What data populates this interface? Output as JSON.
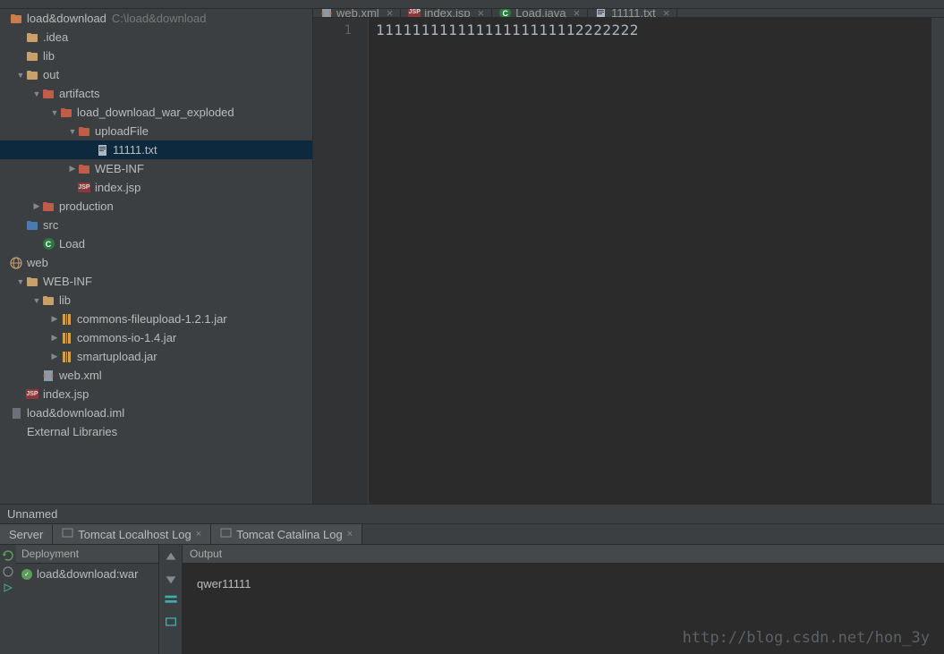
{
  "project": {
    "name": "load&download",
    "path": "C:\\load&download"
  },
  "tree": [
    {
      "indent": 0,
      "arrow": "",
      "iconType": "project",
      "label": "load&download",
      "path": "C:\\load&download"
    },
    {
      "indent": 1,
      "arrow": "",
      "iconType": "folder",
      "label": ".idea"
    },
    {
      "indent": 1,
      "arrow": "",
      "iconType": "folder",
      "label": "lib"
    },
    {
      "indent": 1,
      "arrow": "▼",
      "iconType": "folder",
      "label": "out"
    },
    {
      "indent": 2,
      "arrow": "▼",
      "iconType": "folder-red",
      "label": "artifacts"
    },
    {
      "indent": 3,
      "arrow": "▼",
      "iconType": "folder-red",
      "label": "load_download_war_exploded"
    },
    {
      "indent": 4,
      "arrow": "▼",
      "iconType": "folder-red",
      "label": "uploadFile"
    },
    {
      "indent": 5,
      "arrow": "",
      "iconType": "file",
      "label": "11111.txt",
      "selected": true
    },
    {
      "indent": 4,
      "arrow": "▶",
      "iconType": "folder-red",
      "label": "WEB-INF"
    },
    {
      "indent": 4,
      "arrow": "",
      "iconType": "jsp",
      "label": "index.jsp"
    },
    {
      "indent": 2,
      "arrow": "▶",
      "iconType": "folder-red",
      "label": "production"
    },
    {
      "indent": 1,
      "arrow": "",
      "iconType": "folder-blue",
      "label": "src"
    },
    {
      "indent": 2,
      "arrow": "",
      "iconType": "class",
      "label": "Load"
    },
    {
      "indent": 0,
      "arrow": "",
      "iconType": "web",
      "label": "web"
    },
    {
      "indent": 1,
      "arrow": "▼",
      "iconType": "folder",
      "label": "WEB-INF"
    },
    {
      "indent": 2,
      "arrow": "▼",
      "iconType": "folder",
      "label": "lib"
    },
    {
      "indent": 3,
      "arrow": "▶",
      "iconType": "jar",
      "label": "commons-fileupload-1.2.1.jar"
    },
    {
      "indent": 3,
      "arrow": "▶",
      "iconType": "jar",
      "label": "commons-io-1.4.jar"
    },
    {
      "indent": 3,
      "arrow": "▶",
      "iconType": "jar",
      "label": "smartupload.jar"
    },
    {
      "indent": 2,
      "arrow": "",
      "iconType": "xml",
      "label": "web.xml"
    },
    {
      "indent": 1,
      "arrow": "",
      "iconType": "jsp",
      "label": "index.jsp"
    },
    {
      "indent": 0,
      "arrow": "",
      "iconType": "iml",
      "label": "load&download.iml"
    },
    {
      "indent": 0,
      "arrow": "",
      "iconType": "text",
      "label": "External Libraries"
    }
  ],
  "editorTabs": [
    {
      "icon": "xml",
      "label": "web.xml"
    },
    {
      "icon": "jsp",
      "label": "index.jsp"
    },
    {
      "icon": "class",
      "label": "Load.java"
    },
    {
      "icon": "file",
      "label": "11111.txt",
      "active": true
    }
  ],
  "editor": {
    "gutter": "1",
    "content": "11111111111111111111112222222"
  },
  "run": {
    "config": "Unnamed",
    "tabs": [
      {
        "label": "Server"
      },
      {
        "label": "Tomcat Localhost Log",
        "closable": true
      },
      {
        "label": "Tomcat Catalina Log",
        "closable": true
      }
    ],
    "deployHeader": "Deployment",
    "deployItem": "load&download:war",
    "outputHeader": "Output",
    "outputText": "qwer11111"
  },
  "watermark": "http://blog.csdn.net/hon_3y"
}
